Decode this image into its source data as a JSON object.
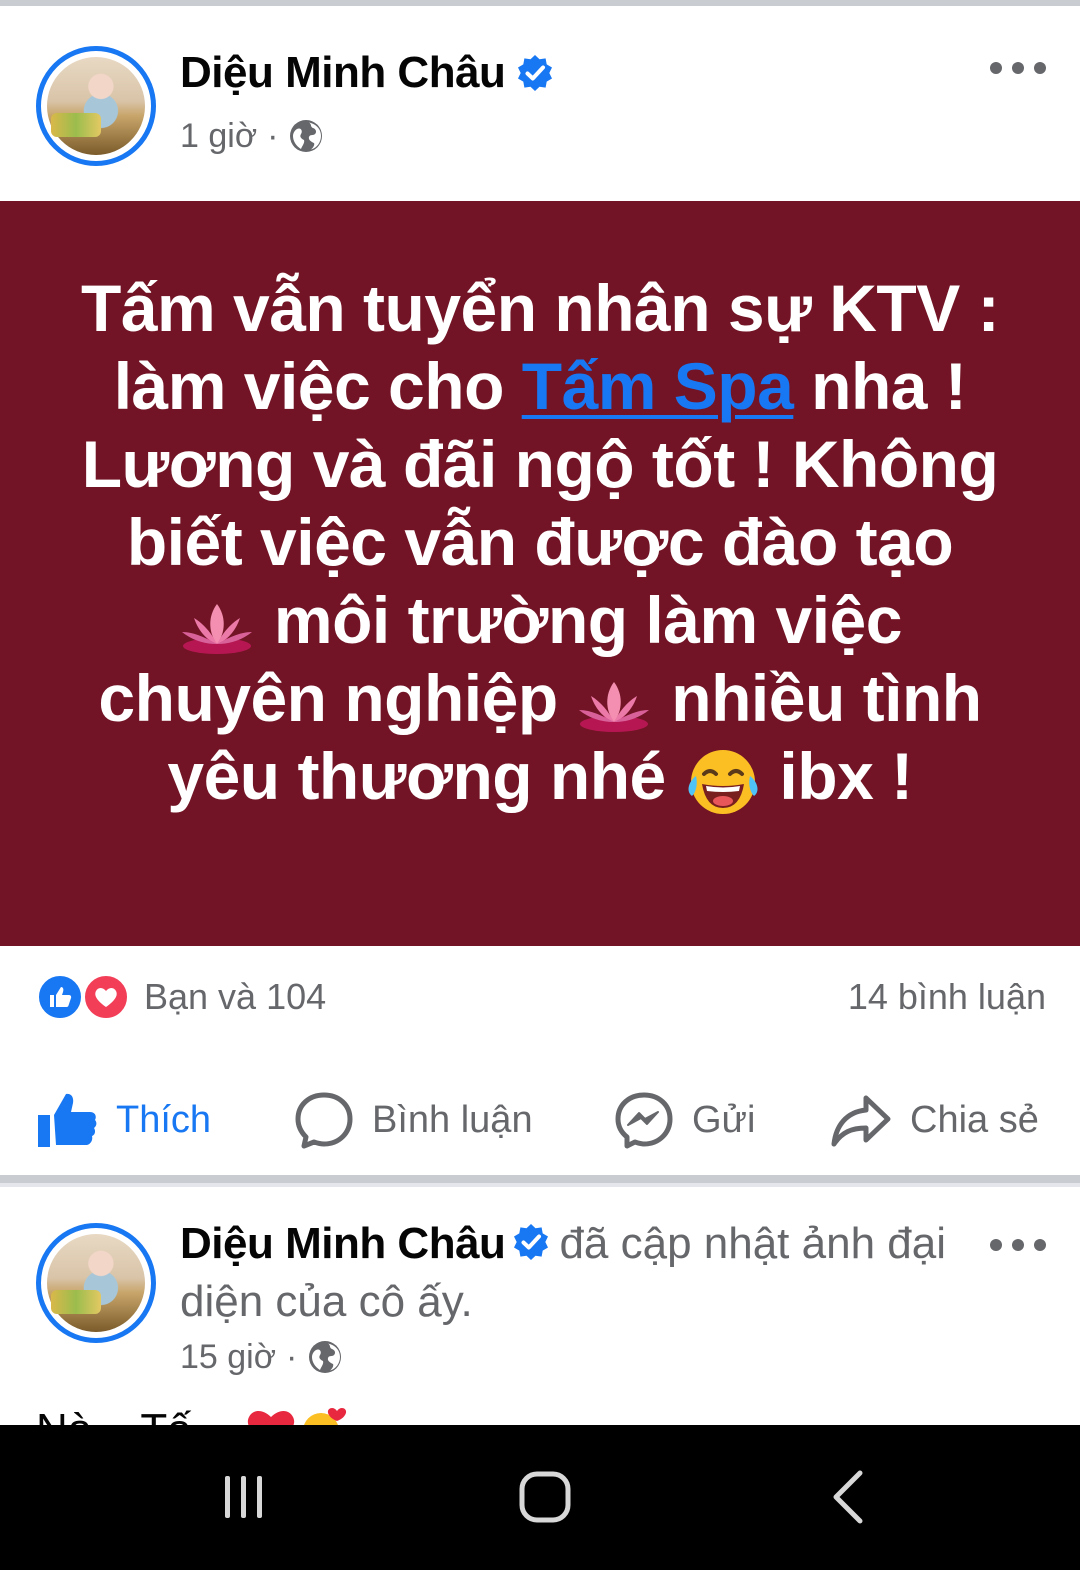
{
  "post1": {
    "author": "Diệu Minh Châu",
    "time": "1 giờ",
    "separator": "·",
    "privacy_icon": "globe-icon",
    "card": {
      "line1": "Tấm vẫn tuyển nhân sự KTV :",
      "line2_before": "làm việc cho ",
      "line2_link": "Tấm Spa",
      "line2_after": " nha !",
      "line3": "Lương và đãi ngộ tốt ! Không",
      "line4": "biết việc vẫn được đào tạo",
      "line5_after_emoji": " môi trường làm việc",
      "line6_before_emoji": "chuyên nghiệp ",
      "line6_after_emoji": " nhiều tình",
      "line7_before_emoji": "yêu thương nhé ",
      "line7_after_emoji": " ibx !",
      "background_color": "#721425",
      "emojis": [
        "lotus",
        "lotus",
        "face-with-tears-of-joy"
      ]
    },
    "reactions_text": "Bạn và 104",
    "comments_text": "14 bình luận",
    "actions": {
      "like": "Thích",
      "comment": "Bình luận",
      "send": "Gửi",
      "share": "Chia sẻ"
    }
  },
  "post2": {
    "author": "Diệu Minh Châu",
    "activity": "đã cập nhật ảnh đại diện của cô ấy.",
    "time": "15 giờ",
    "separator": "·",
    "peek_text": "Nà... Tấ..."
  },
  "colors": {
    "accent": "#1877f2",
    "secondary_text": "#65676b",
    "love": "#f33e58"
  },
  "navbar": {
    "icons": [
      "recent-apps-icon",
      "home-icon",
      "back-icon"
    ]
  }
}
